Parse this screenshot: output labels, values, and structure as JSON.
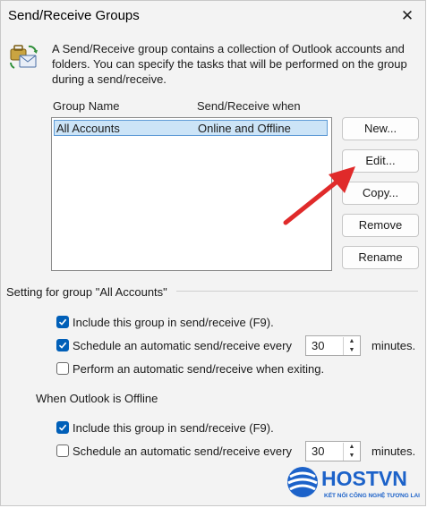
{
  "window": {
    "title": "Send/Receive Groups",
    "close_glyph": "✕"
  },
  "description": "A Send/Receive group contains a collection of Outlook accounts and folders. You can specify the tasks that will be performed on the group during a send/receive.",
  "groups_table": {
    "columns": [
      "Group Name",
      "Send/Receive when"
    ],
    "rows": [
      {
        "name": "All Accounts",
        "when": "Online and Offline",
        "selected": true
      }
    ]
  },
  "buttons": {
    "new": "New...",
    "edit": "Edit...",
    "copy": "Copy...",
    "remove": "Remove",
    "rename": "Rename"
  },
  "settings": {
    "section_title": "Setting for group \"All Accounts\"",
    "include_label": "Include this group in send/receive (F9).",
    "include_checked": true,
    "schedule_label": "Schedule an automatic send/receive every",
    "schedule_checked": true,
    "schedule_minutes": "30",
    "minutes_label": "minutes.",
    "exit_label": "Perform an automatic send/receive when exiting.",
    "exit_checked": false
  },
  "offline": {
    "section_title": "When Outlook is Offline",
    "include_label": "Include this group in send/receive (F9).",
    "include_checked": true,
    "schedule_label": "Schedule an automatic send/receive every",
    "schedule_checked": false,
    "schedule_minutes": "30",
    "minutes_label": "minutes."
  },
  "watermark": {
    "brand": "HOSTVN",
    "tagline": "KẾT NỐI CÔNG NGHỆ TƯƠNG LAI"
  },
  "colors": {
    "accent": "#005fb8",
    "selection": "#cce4f7",
    "annotation_arrow": "#e02a2a"
  }
}
